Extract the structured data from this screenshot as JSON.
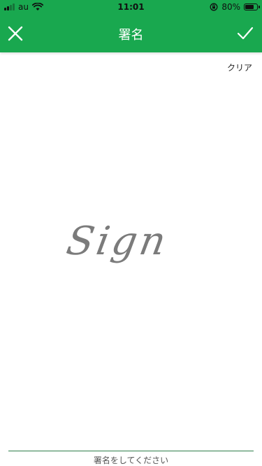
{
  "status_bar": {
    "carrier": "au",
    "time": "11:01",
    "battery_percent": "80%",
    "battery_level": 0.8,
    "icons": [
      "signal-bars-icon",
      "wifi-icon",
      "orientation-lock-icon",
      "battery-icon"
    ]
  },
  "nav": {
    "title": "署名",
    "close_icon": "close-icon",
    "done_icon": "check-icon"
  },
  "colors": {
    "nav_bg": "#19a84f",
    "guide_line": "#2f7d4a",
    "sign_placeholder": "#7b7b7b"
  },
  "toolbar": {
    "clear_label": "クリア"
  },
  "signature": {
    "placeholder_text": "Sign",
    "hint": "署名をしてください"
  }
}
